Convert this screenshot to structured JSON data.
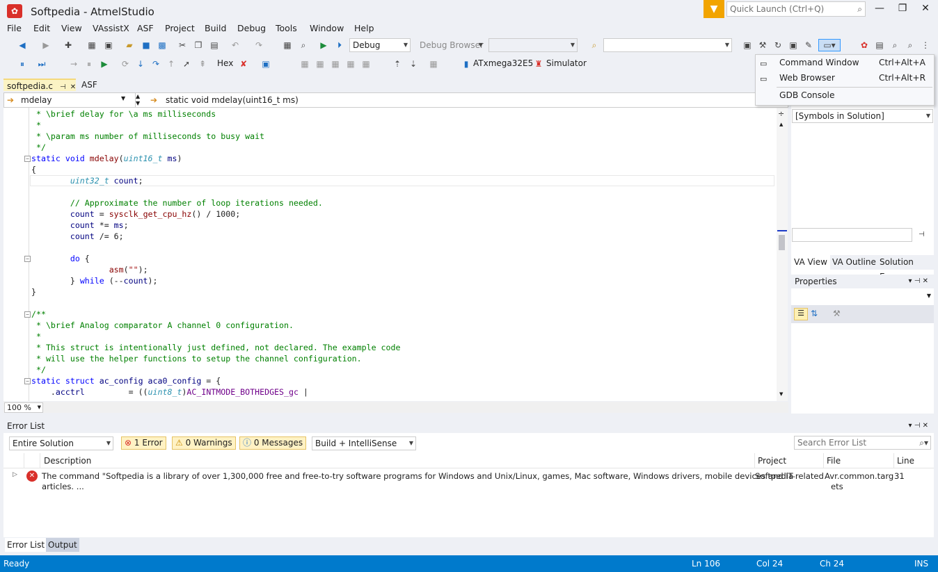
{
  "window": {
    "title": "Softpedia - AtmelStudio",
    "quick_launch_placeholder": "Quick Launch (Ctrl+Q)"
  },
  "menu": [
    "File",
    "Edit",
    "View",
    "VAssistX",
    "ASF",
    "Project",
    "Build",
    "Debug",
    "Tools",
    "Window",
    "Help"
  ],
  "toolbar": {
    "config": "Debug",
    "debug_browser": "Debug Browser",
    "hex_label": "Hex",
    "device": "ATxmega32E5",
    "tool": "Simulator"
  },
  "tabs": {
    "active": "softpedia.c",
    "second": "ASF Wizard"
  },
  "navbar": {
    "left": "mdelay",
    "right": "static void mdelay(uint16_t ms)"
  },
  "context_menu": {
    "items": [
      {
        "label": "Command Window",
        "shortcut": "Ctrl+Alt+A"
      },
      {
        "label": "Web Browser",
        "shortcut": "Ctrl+Alt+R"
      },
      {
        "label": "GDB Console",
        "shortcut": ""
      }
    ]
  },
  "right_panel": {
    "symbols_combo": "[Symbols in Solution]",
    "tabs": [
      "VA View",
      "VA Outline",
      "Solution Ex..."
    ],
    "properties_title": "Properties"
  },
  "editor": {
    "zoom": "100 %"
  },
  "error_list": {
    "title": "Error List",
    "scope": "Entire Solution",
    "errors_label": "1 Error",
    "warnings_label": "0 Warnings",
    "messages_label": "0 Messages",
    "build_filter": "Build + IntelliSense",
    "search_placeholder": "Search Error List",
    "columns": {
      "description": "Description",
      "project": "Project",
      "file": "File",
      "line": "Line"
    },
    "row": {
      "description_line1": "The command \"Softpedia is a library of over 1,300,000 free and free-to-try software programs for Windows and Unix/Linux, games, Mac software, Windows drivers, mobile devices and IT-related",
      "description_line2": "articles.  ...",
      "project": "Softpedia",
      "file_line1": "Avr.common.targ",
      "file_line2": "ets",
      "line": "31"
    }
  },
  "bottom_tabs": [
    "Error List",
    "Output"
  ],
  "status": {
    "ready": "Ready",
    "ln": "Ln 106",
    "col": "Col 24",
    "ch": "Ch 24",
    "mode": "INS"
  },
  "code_lines": [
    " * \\brief delay for \\a ms milliseconds",
    " *",
    " * \\param ms number of milliseconds to busy wait",
    " */",
    "static void mdelay(uint16_t ms)",
    "{",
    "        uint32_t count;",
    "",
    "        // Approximate the number of loop iterations needed.",
    "        count = sysclk_get_cpu_hz() / 1000;",
    "        count *= ms;",
    "        count /= 6;",
    "",
    "        do {",
    "                asm(\"\");",
    "        } while (--count);",
    "}",
    "",
    "/**",
    " * \\brief Analog comparator A channel 0 configuration.",
    " *",
    " * This struct is intentionally just defined, not declared. The example code",
    " * will use the helper functions to setup the channel configuration.",
    " */",
    "static struct ac_config aca0_config = {",
    "    .acctrl         = ((uint8_t)AC_INTMODE_BOTHEDGES_gc |"
  ]
}
